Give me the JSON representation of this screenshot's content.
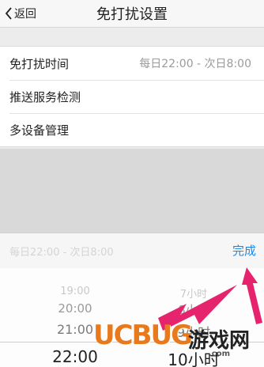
{
  "nav": {
    "back_label": "返回",
    "title": "免打扰设置"
  },
  "settings": {
    "rows": [
      {
        "label": "免打扰时间",
        "value": "每日22:00 - 次日8:00"
      },
      {
        "label": "推送服务检测",
        "value": ""
      },
      {
        "label": "多设备管理",
        "value": ""
      }
    ]
  },
  "toolbar": {
    "text": "每日22:00 - 次日8:00",
    "done_label": "完成"
  },
  "picker": {
    "left": [
      "19:00",
      "20:00",
      "21:00",
      "22:00"
    ],
    "right": [
      "7小时",
      "8小时",
      "9小时",
      "10小时"
    ]
  },
  "watermark": {
    "brand": "UCBUG",
    "text": "游戏网",
    "sub": ".com"
  },
  "colors": {
    "accent": "#1e88e5",
    "arrow": "#e6246e"
  }
}
